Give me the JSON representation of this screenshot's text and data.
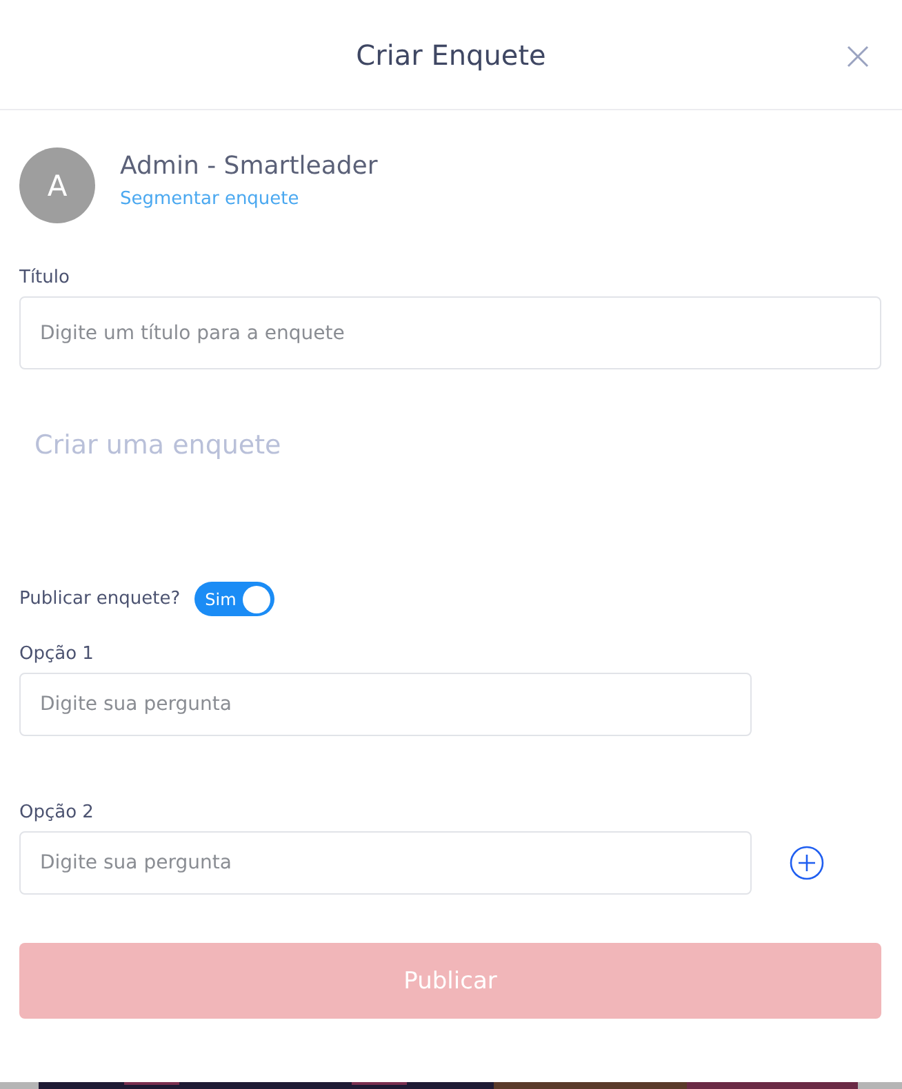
{
  "dialog": {
    "title": "Criar Enquete"
  },
  "author": {
    "initial": "A",
    "name": "Admin - Smartleader",
    "segment_link": "Segmentar enquete"
  },
  "title_field": {
    "label": "Título",
    "placeholder": "Digite um título para a enquete"
  },
  "editor": {
    "placeholder": "Criar uma enquete"
  },
  "publish_toggle": {
    "label": "Publicar enquete?",
    "on": true,
    "text": "Sim"
  },
  "options": [
    {
      "label": "Opção 1",
      "placeholder": "Digite sua pergunta"
    },
    {
      "label": "Opção 2",
      "placeholder": "Digite sua pergunta"
    }
  ],
  "submit": {
    "label": "Publicar",
    "disabled": true
  }
}
